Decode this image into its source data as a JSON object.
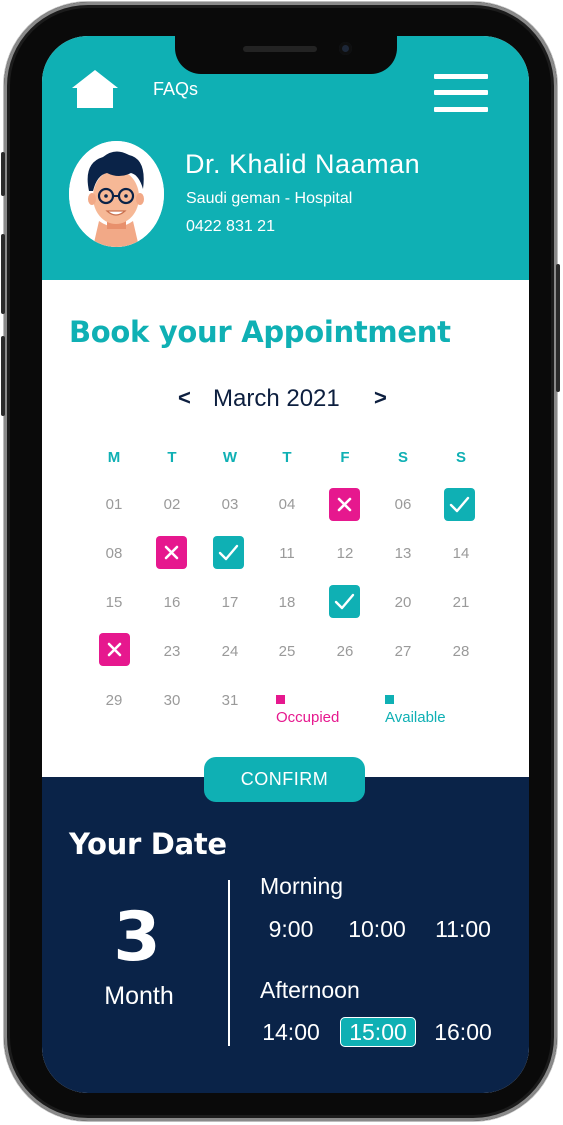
{
  "header": {
    "faqs_label": "FAQs",
    "doctor_name": "Dr. Khalid Naaman",
    "hospital": "Saudi geman - Hospital",
    "phone": "0422 831 21"
  },
  "booking": {
    "title": "Book your Appointment",
    "month_label": "March 2021",
    "prev_arrow": "<",
    "next_arrow": ">",
    "weekdays": [
      "M",
      "T",
      "W",
      "T",
      "F",
      "S",
      "S"
    ],
    "days": [
      [
        "01",
        "02",
        "03",
        "04",
        "",
        "06",
        ""
      ],
      [
        "08",
        "",
        "",
        "11",
        "12",
        "13",
        "14"
      ],
      [
        "15",
        "16",
        "17",
        "18",
        "",
        "20",
        "21"
      ],
      [
        "",
        "23",
        "24",
        "25",
        "26",
        "27",
        "28"
      ],
      [
        "29",
        "30",
        "31",
        "",
        "",
        "",
        ""
      ]
    ],
    "legend_occupied": "Occupied",
    "legend_available": "Available"
  },
  "colors": {
    "teal": "#0fb0b4",
    "pink": "#e6188e",
    "navy": "#0a2348"
  },
  "confirm_label": "CONFIRM",
  "your_date": {
    "title": "Your Date",
    "number": "3",
    "unit": "Month",
    "morning_label": "Morning",
    "morning_slots": [
      "9:00",
      "10:00",
      "11:00"
    ],
    "afternoon_label": "Afternoon",
    "afternoon_slots": [
      "14:00",
      "15:00",
      "16:00"
    ],
    "selected_slot": "15:00"
  }
}
